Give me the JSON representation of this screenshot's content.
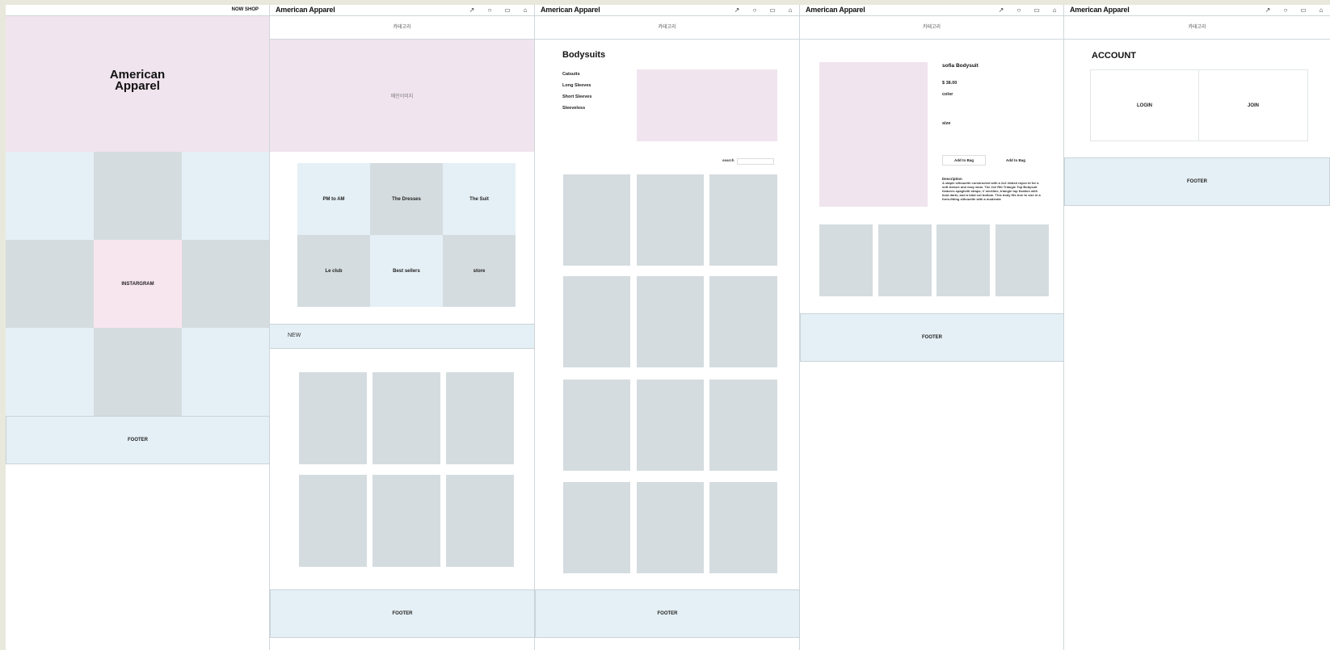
{
  "brand": "American Apparel",
  "category_label": "카테고리",
  "footer_label": "FOOTER",
  "header_icons": [
    "pin-icon",
    "chat-icon",
    "cart-icon",
    "user-icon"
  ],
  "home": {
    "now_shop": "NOW SHOP",
    "logo_line1": "American",
    "logo_line2": "Apparel",
    "instagram": "INSTARGRAM"
  },
  "main": {
    "main_image": "메인이미지",
    "tiles": [
      "PM to AM",
      "The Dresses",
      "The Suit",
      "Le club",
      "Best sellers",
      "store"
    ],
    "new_label": "NEW"
  },
  "listing": {
    "title": "Bodysuits",
    "subcategories": [
      "Catsuits",
      "Long Sleeves",
      "Short Sleeves",
      "Sleeveless"
    ],
    "search_label": "search"
  },
  "product": {
    "name": "sofia Bodysuit",
    "price": "$ 38.00",
    "color_label": "color",
    "size_label": "size",
    "add_to_bag_1": "Add to Bag",
    "add_to_bag_2": "Add to Bag",
    "description_title": "Description",
    "description_text": "A staple silhouette constructed with a 2x2 ribbed rayon bl for a soft texture and easy wear. The 2x2 Rib Triangle Top Bodysuit features spaghetti straps, V neckline, triangle top fixation with bust darts, and a total cut bottom. This body fits true to size in a form-fitting silhouette with a moderate"
  },
  "account": {
    "title": "ACCOUNT",
    "login": "LOGIN",
    "join": "JOIN"
  },
  "colors": {
    "pink": "#f0e4ee",
    "light_blue": "#e5f0f6",
    "gray": "#d5dcdf",
    "background": "#e8e8dc"
  }
}
